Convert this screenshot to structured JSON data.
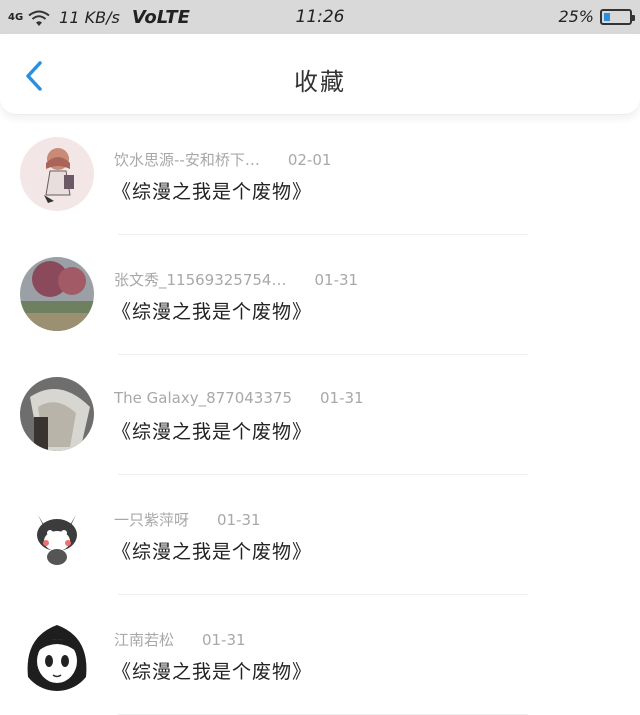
{
  "status_bar": {
    "network": "4G",
    "speed": "11 KB/s",
    "volte": "VoLTE",
    "time": "11:26",
    "battery": "25%",
    "battery_level": 0.25
  },
  "header": {
    "title": "收藏"
  },
  "list": [
    {
      "name": "饮水思源--安和桥下…",
      "date": "02-01",
      "message": "《综漫之我是个废物》"
    },
    {
      "name": "张文秀_11569325754…",
      "date": "01-31",
      "message": "《综漫之我是个废物》"
    },
    {
      "name": "The Galaxy_877043375",
      "date": "01-31",
      "message": "《综漫之我是个废物》"
    },
    {
      "name": "一只紫萍呀",
      "date": "01-31",
      "message": "《综漫之我是个废物》"
    },
    {
      "name": "江南若松",
      "date": "01-31",
      "message": "《综漫之我是个废物》"
    }
  ],
  "colors": {
    "accent": "#2b8fe0",
    "status_bar_bg": "#d9d9d9"
  }
}
